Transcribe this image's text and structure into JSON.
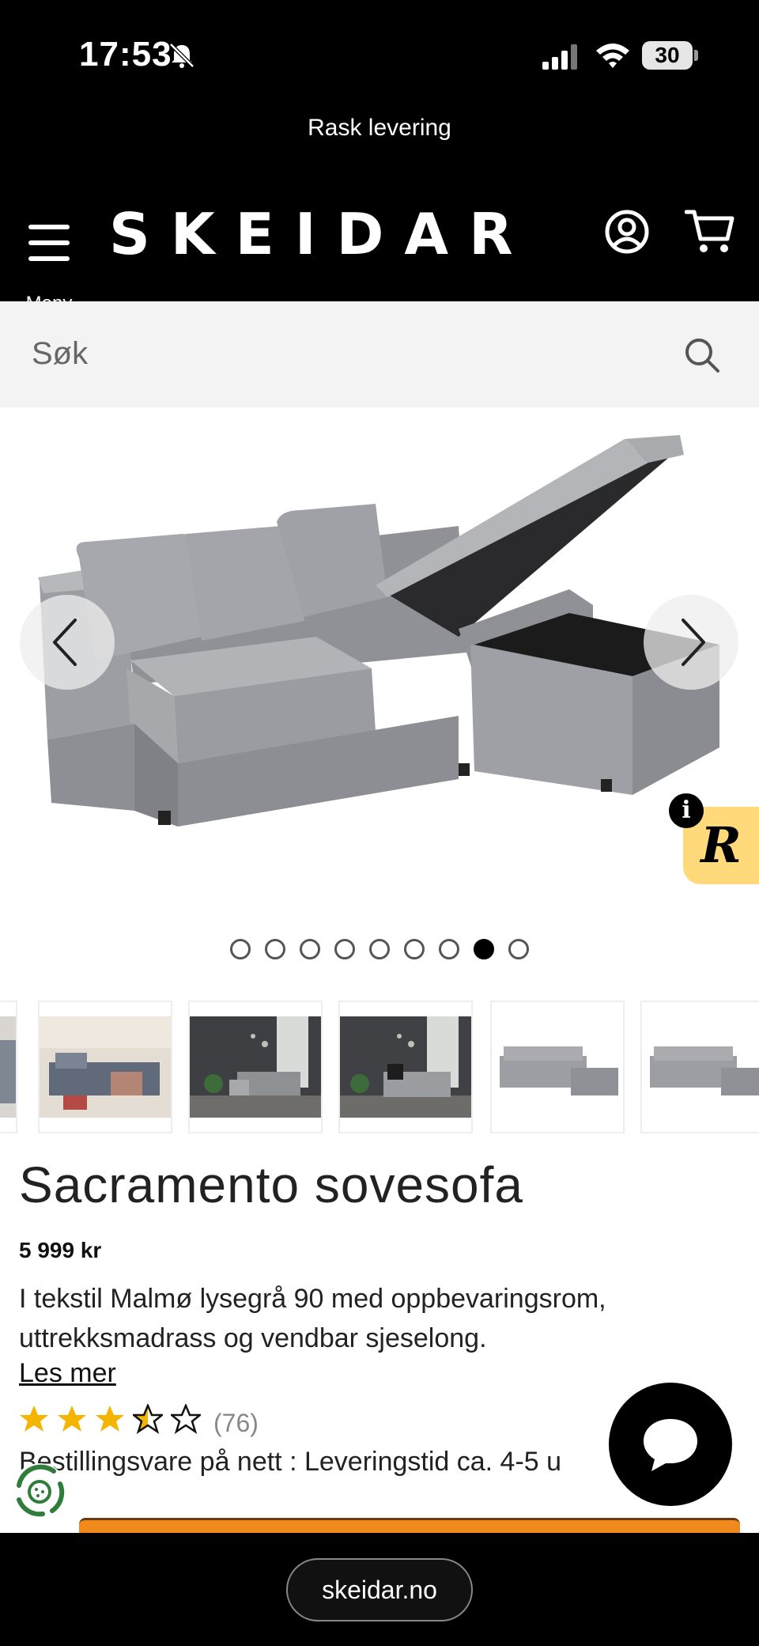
{
  "status_bar": {
    "time": "17:53",
    "battery": "30",
    "icons": [
      "bell-off-icon",
      "signal-icon",
      "wifi-icon",
      "battery-icon"
    ]
  },
  "promo": {
    "text": "Rask levering"
  },
  "header": {
    "menu_label": "Meny",
    "logo": "SKEIDAR",
    "icons": [
      "menu-icon",
      "account-icon",
      "cart-icon"
    ]
  },
  "search": {
    "placeholder": "Søk",
    "icon": "search-icon"
  },
  "gallery": {
    "image_count": 9,
    "active_index": 7,
    "prev_icon": "chevron-left-icon",
    "next_icon": "chevron-right-icon",
    "info_badge": "i",
    "r_badge": "R",
    "thumbnails": [
      "thumb-partial",
      "thumb-living-room",
      "thumb-dark-wall-1",
      "thumb-dark-wall-2",
      "thumb-sofa-studio",
      "thumb-sofa-studio-2"
    ]
  },
  "product": {
    "title": "Sacramento sovesofa",
    "price": "5 999 kr",
    "description": "I tekstil Malmø lysegrå 90 med oppbevaringsrom, uttrekksmadrass og vendbar sjeselong.",
    "read_more": "Les mer",
    "rating": 3.5,
    "review_count": "(76)",
    "delivery": "Bestillingsvare på nett : Leveringstid ca. 4-5 u"
  },
  "browser": {
    "url": "skeidar.no"
  },
  "colors": {
    "brand_black": "#000000",
    "accent_orange": "#f08a1d",
    "star_yellow": "#f5b400",
    "badge_yellow": "#ffd97a"
  }
}
